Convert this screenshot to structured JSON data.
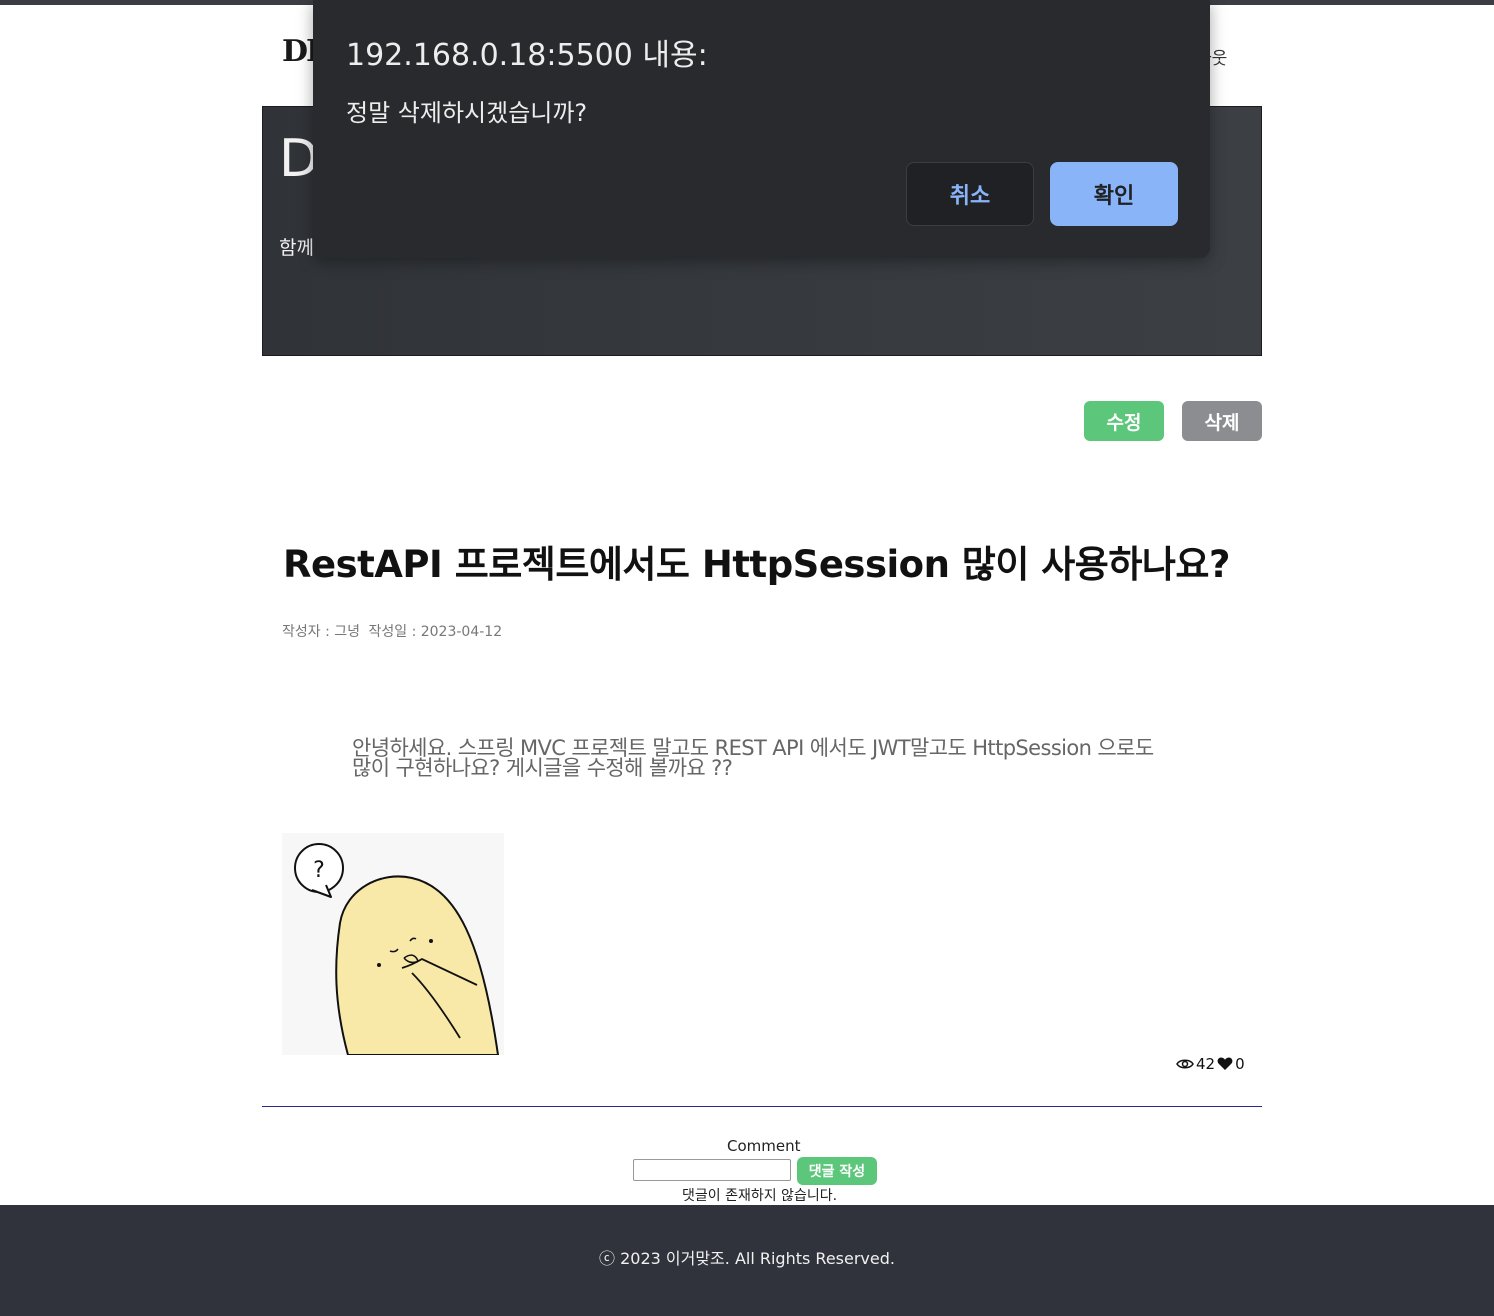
{
  "header": {
    "brand": "DE",
    "logout_label": "아웃"
  },
  "hero": {
    "title": "D",
    "subtitle": "함께"
  },
  "actions": {
    "edit_label": "수정",
    "delete_label": "삭제"
  },
  "post": {
    "title": "RestAPI 프로젝트에서도 HttpSession 많이 사용하나요?",
    "author": "작성자 : 그녕",
    "date": "작성일 : 2023-04-12",
    "body": "안녕하세요. 스프링 MVC 프로젝트 말고도 REST API 에서도 JWT말고도 HttpSession 으로도 많이 구현하나요? 게시글을 수정해 볼까요 ??",
    "image_glyph": "?",
    "views": "42",
    "likes": "0"
  },
  "comments": {
    "label": "Comment",
    "input_value": "",
    "submit_label": "댓글 작성",
    "empty_message": "댓글이 존재하지 않습니다."
  },
  "footer": {
    "copyright": "ⓒ 2023 이거맞조. All Rights Reserved."
  },
  "dialog": {
    "title": "192.168.0.18:5500 내용:",
    "message": "정말 삭제하시겠습니까?",
    "cancel_label": "취소",
    "ok_label": "확인"
  },
  "colors": {
    "accent_green": "#5cc67a",
    "delete_gray": "#8b8d90",
    "dialog_bg": "#292a2d",
    "dialog_ok": "#8ab4f8",
    "footer_bg": "#30333b"
  }
}
